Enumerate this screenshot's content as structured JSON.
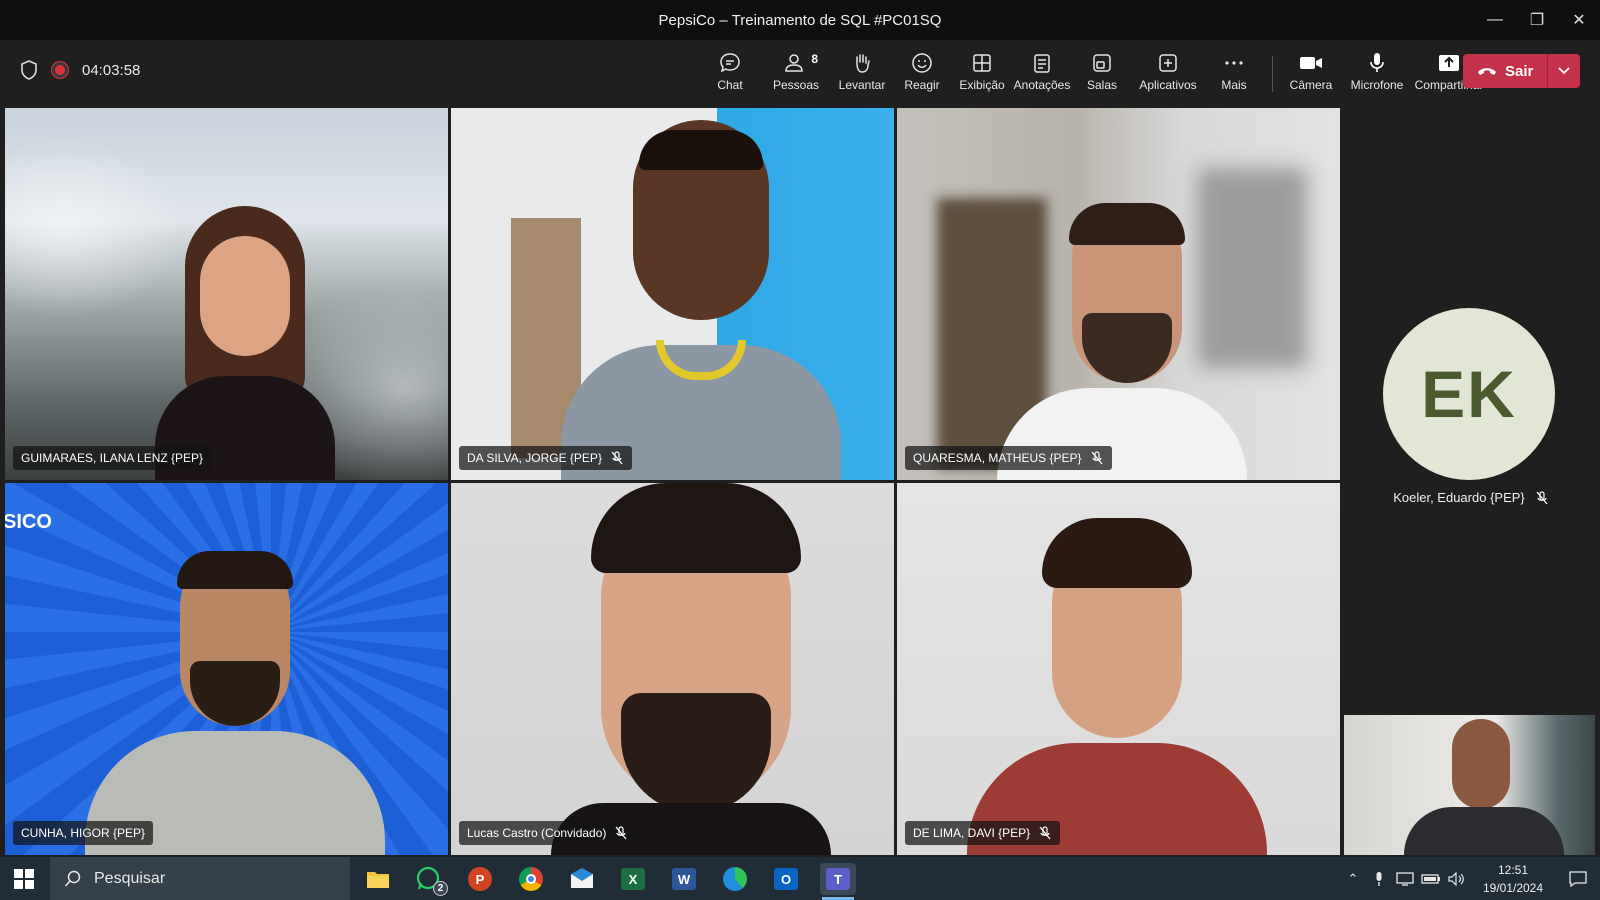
{
  "window": {
    "title": "PepsiCo – Treinamento de SQL #PC01SQ"
  },
  "meeting": {
    "timer": "04:03:58",
    "people_count": "8"
  },
  "toolbar": {
    "items": [
      {
        "label": "Chat",
        "icon": "chat-icon"
      },
      {
        "label": "Pessoas",
        "icon": "people-icon"
      },
      {
        "label": "Levantar",
        "icon": "raise-hand-icon"
      },
      {
        "label": "Reagir",
        "icon": "react-icon"
      },
      {
        "label": "Exibição",
        "icon": "view-icon"
      },
      {
        "label": "Anotações",
        "icon": "notes-icon"
      },
      {
        "label": "Salas",
        "icon": "rooms-icon"
      },
      {
        "label": "Aplicativos",
        "icon": "apps-icon"
      },
      {
        "label": "Mais",
        "icon": "more-icon"
      }
    ],
    "devices": [
      {
        "label": "Câmera",
        "icon": "camera-icon"
      },
      {
        "label": "Microfone",
        "icon": "microphone-icon"
      },
      {
        "label": "Compartilhar",
        "icon": "share-icon"
      }
    ],
    "leave_label": "Sair"
  },
  "participants": [
    {
      "name": "GUIMARAES, ILANA LENZ {PEP}",
      "muted": false
    },
    {
      "name": "DA SILVA, JORGE {PEP}",
      "muted": true
    },
    {
      "name": "QUARESMA, MATHEUS {PEP}",
      "muted": true
    },
    {
      "name": "CUNHA, HIGOR {PEP}",
      "muted": false
    },
    {
      "name": "Lucas Castro (Convidado)",
      "muted": true
    },
    {
      "name": "DE LIMA, DAVI {PEP}",
      "muted": true
    }
  ],
  "audio_only": {
    "initials": "EK",
    "name": "Koeler, Eduardo {PEP}",
    "muted": true
  },
  "tile_text": {
    "background_logo": "SICO"
  },
  "taskbar": {
    "search_placeholder": "Pesquisar",
    "whatsapp_badge": "2",
    "time": "12:51",
    "date": "19/01/2024"
  },
  "colors": {
    "leave": "#c4314b",
    "recording": "#e0303d",
    "avatar_bg": "#e2e6d4",
    "avatar_text": "#4b5b2e"
  }
}
